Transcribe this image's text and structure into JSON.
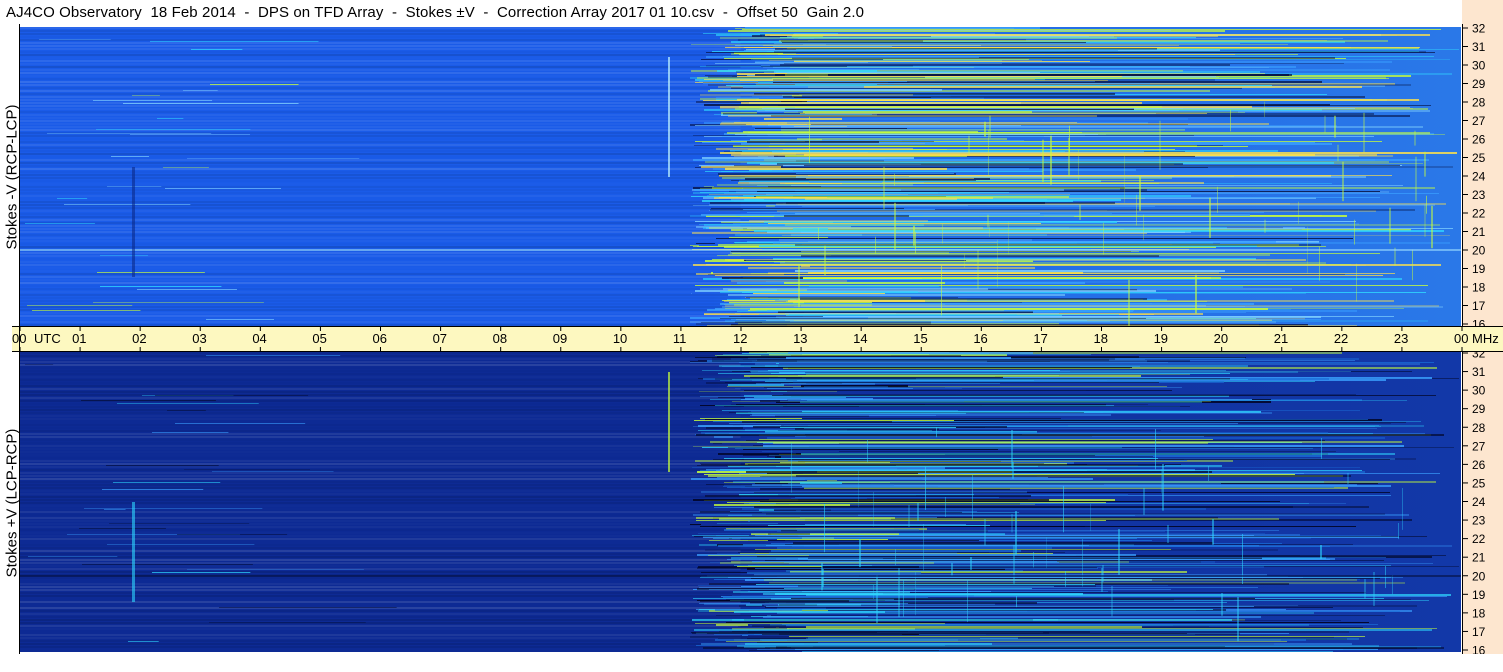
{
  "title": "AJ4CO Observatory  18 Feb 2014  -  DPS on TFD Array  -  Stokes ±V  -  Correction Array 2017 01 10.csv  -  Offset 50  Gain 2.0",
  "colors": {
    "top_base": "#1a5be8",
    "bottom_base": "#0d2a94",
    "time_axis_bg": "#fdf8c0",
    "freq_axis_bg": "#fde6cf",
    "band_bright": "#c8ff3a",
    "band_cyan": "#2fd7ff",
    "band_dark": "#051040"
  },
  "chart_data": [
    {
      "type": "heatmap",
      "panel": "top",
      "ylabel": "Stokes -V (RCP-LCP)",
      "y_ticks": [
        "32",
        "31",
        "30",
        "29",
        "28",
        "27",
        "26",
        "25",
        "24",
        "23",
        "22",
        "21",
        "20",
        "19",
        "18",
        "17",
        "16"
      ],
      "ylim": [
        16,
        32
      ],
      "x_ticks": [
        "00",
        "01",
        "02",
        "03",
        "04",
        "05",
        "06",
        "07",
        "08",
        "09",
        "10",
        "11",
        "12",
        "13",
        "14",
        "15",
        "16",
        "17",
        "18",
        "19",
        "20",
        "21",
        "22",
        "23",
        "00"
      ],
      "xlim": [
        0,
        24
      ],
      "x_unit": "UTC",
      "y_unit": "MHz",
      "grid": false
    },
    {
      "type": "heatmap",
      "panel": "bottom",
      "ylabel": "Stokes +V (LCP-RCP)",
      "y_ticks": [
        "32",
        "31",
        "30",
        "29",
        "28",
        "27",
        "26",
        "25",
        "24",
        "23",
        "22",
        "21",
        "20",
        "19",
        "18",
        "17",
        "16"
      ],
      "ylim": [
        16,
        32
      ],
      "x_ticks": [
        "00",
        "01",
        "02",
        "03",
        "04",
        "05",
        "06",
        "07",
        "08",
        "09",
        "10",
        "11",
        "12",
        "13",
        "14",
        "15",
        "16",
        "17",
        "18",
        "19",
        "20",
        "21",
        "22",
        "23",
        "00"
      ],
      "xlim": [
        0,
        24
      ],
      "x_unit": "UTC",
      "y_unit": "MHz",
      "grid": false
    }
  ],
  "axis": {
    "utc_label": "UTC",
    "mhz_label": "MHz"
  }
}
